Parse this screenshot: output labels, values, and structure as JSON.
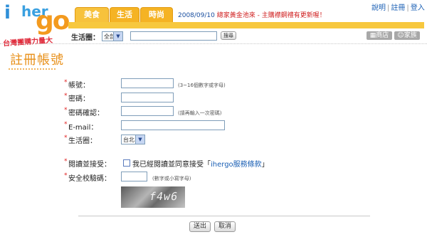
{
  "logo": {
    "i": "i",
    "her": "her",
    "go": "go",
    "slogan": "台灣團購力量大"
  },
  "tabs": [
    "美食",
    "生活",
    "時尚"
  ],
  "news": {
    "date": "2008/09/10",
    "text": "總家黃金池來 - 主購襟鋼禮有更新喔！"
  },
  "toplinks": {
    "help": "說明",
    "register": "註冊",
    "login": "登入"
  },
  "search": {
    "label": "生活圈：",
    "scope": "全部",
    "button": "搜尋"
  },
  "quick_buttons": {
    "store": "商店",
    "family": "家族"
  },
  "page_title": "註冊帳號",
  "form": {
    "account": {
      "label": "帳號：",
      "hint": "(3~16個數字或字母)"
    },
    "password": {
      "label": "密碼："
    },
    "password_confirm": {
      "label": "密碼確認：",
      "hint": "(請再輸入一次密碼)"
    },
    "email": {
      "label": "E-mail："
    },
    "area": {
      "label": "生活圈：",
      "value": "台北"
    },
    "agree": {
      "label": "閱讀並接受：",
      "text": "我已經閱讀並同意接受「",
      "link": "ihergo服務條款",
      "end": "」"
    },
    "captcha": {
      "label": "安全校驗碼：",
      "hint": "(數字或小寫字母)",
      "code": "f4w6"
    }
  },
  "actions": {
    "submit": "送出",
    "cancel": "取消"
  },
  "colors": {
    "accent_orange": "#f5b324",
    "link_blue": "#1a5fb4",
    "required_red": "#e02020"
  }
}
